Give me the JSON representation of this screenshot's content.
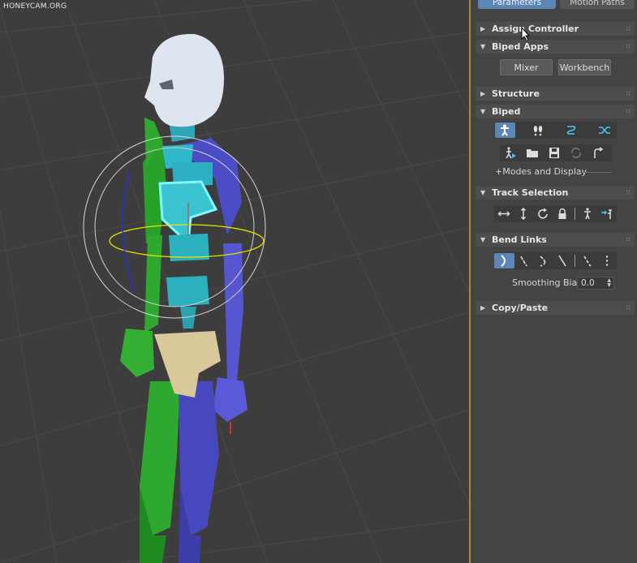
{
  "watermark": "HONEYCAM.ORG",
  "tabs": {
    "parameters": "Parameters",
    "motion_paths": "Motion Paths"
  },
  "rollouts": {
    "assign_controller": "Assign Controller",
    "biped_apps": "Biped Apps",
    "structure": "Structure",
    "biped": "Biped",
    "track_selection": "Track Selection",
    "bend_links": "Bend Links",
    "copy_paste": "Copy/Paste"
  },
  "biped_apps": {
    "mixer": "Mixer",
    "workbench": "Workbench"
  },
  "biped": {
    "modes_display": "+Modes and Display"
  },
  "bend_links": {
    "smoothing_label": "Smoothing Bias:",
    "smoothing_value": "0.0"
  },
  "colors": {
    "accent": "#5b86b5",
    "panel_bg": "#444444",
    "viewport_bg": "#3d3d3d",
    "frame": "#b08a2e"
  },
  "icons": {
    "biped_row1": [
      "figure-mode-icon",
      "footstep-mode-icon",
      "motion-flow-icon",
      "mixer-mode-icon"
    ],
    "biped_row2": [
      "play-biped-icon",
      "load-file-icon",
      "save-file-icon",
      "convert-icon",
      "move-all-icon"
    ],
    "track_selection": [
      "body-horizontal-icon",
      "body-vertical-icon",
      "body-rotation-icon",
      "lock-com-icon",
      "symmetrical-icon",
      "opposite-icon"
    ],
    "bend_links": [
      "bend-links-icon",
      "twist-links-icon",
      "twist-individual-icon",
      "smooth-twist-icon",
      "zero-twist-icon",
      "bone-axis-icon"
    ]
  }
}
